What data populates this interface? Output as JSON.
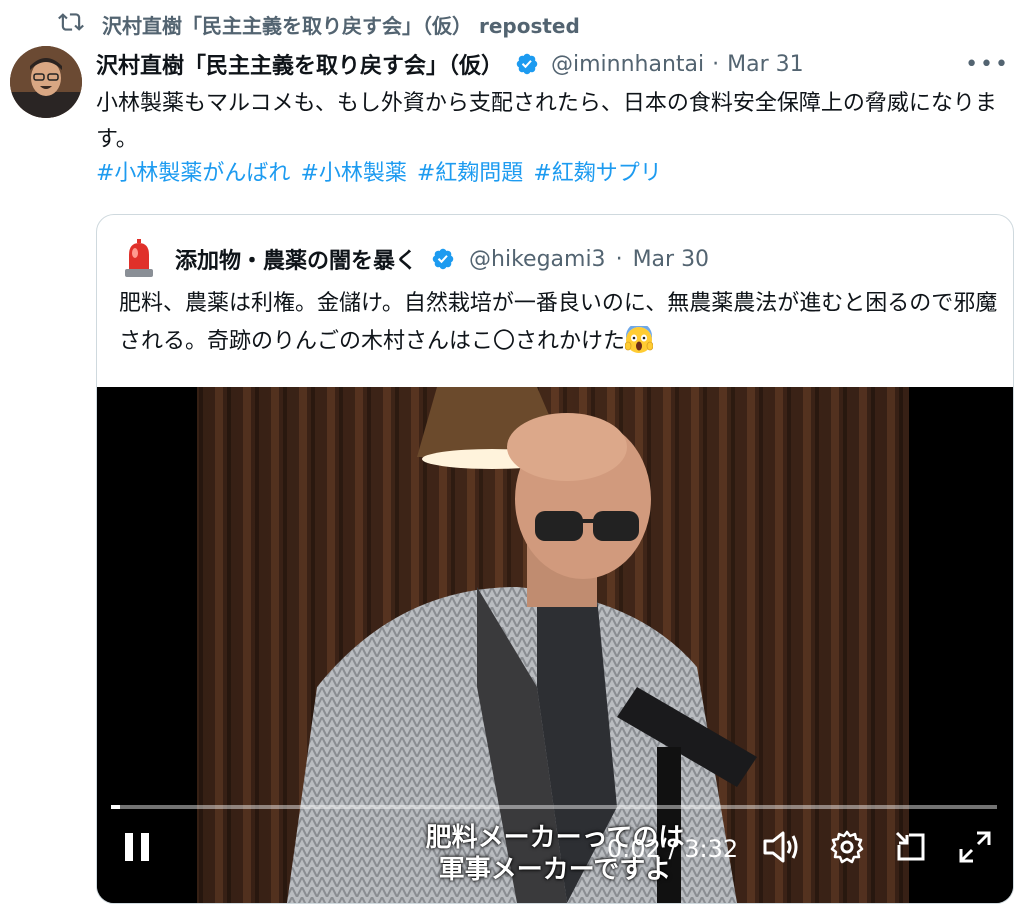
{
  "repost": {
    "label": "沢村直樹「民主主義を取り戻す会」（仮） reposted"
  },
  "tweet": {
    "author_name": "沢村直樹「民主主義を取り戻す会」（仮）",
    "handle": "@iminnhantai",
    "separator": "·",
    "date": "Mar 31",
    "more_label": "•••",
    "text": "小林製薬もマルコメも、もし外資から支配されたら、日本の食料安全保障上の脅威になります。",
    "hashtags": [
      "#小林製薬がんばれ",
      "#小林製薬",
      "#紅麹問題",
      "#紅麹サプリ"
    ]
  },
  "quoted": {
    "author_name": "添加物・農薬の闇を暴く",
    "handle": "@hikegami3",
    "separator": "·",
    "date": "Mar 30",
    "text": "肥料、農薬は利権。金儲け。自然栽培が一番良いのに、無農薬農法が進むと困るので邪魔される。奇跡のりんごの木村さんはこ〇されかけた",
    "emoji": "face-screaming-in-fear"
  },
  "video": {
    "subtitle_line1": "肥料メーカーってのは",
    "subtitle_line2": "軍事メーカーですよ",
    "current_time": "0:02",
    "time_separator": " / ",
    "duration": "3:32",
    "progress_fraction": 0.01
  },
  "colors": {
    "link": "#1d9bf0",
    "verified": "#1d9bf0",
    "secondary_text": "#536471"
  }
}
